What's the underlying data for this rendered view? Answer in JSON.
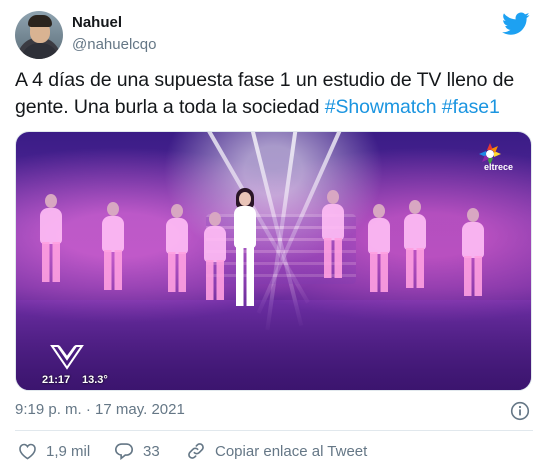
{
  "user": {
    "display_name": "Nahuel",
    "handle": "@nahuelcqo",
    "avatar_icon": "avatar"
  },
  "brand": {
    "icon": "twitter-bird-icon",
    "color": "#1da1f2"
  },
  "tweet": {
    "text_plain": "A 4 días de una supuesta fase 1 un estudio de TV lleno de gente. Una burla a toda la sociedad ",
    "hashtag_1": "#Showmatch",
    "space": " ",
    "hashtag_2": "#fase1",
    "hashtag_color": "#1b95e0"
  },
  "media": {
    "channel_label": "eltrece",
    "clock_time": "21:17",
    "clock_temp": "13.3°"
  },
  "meta": {
    "timestamp": "9:19 p. m. · 17 may. 2021"
  },
  "actions": {
    "likes": "1,9 mil",
    "replies": "33",
    "copy_link": "Copiar enlace al Tweet"
  }
}
